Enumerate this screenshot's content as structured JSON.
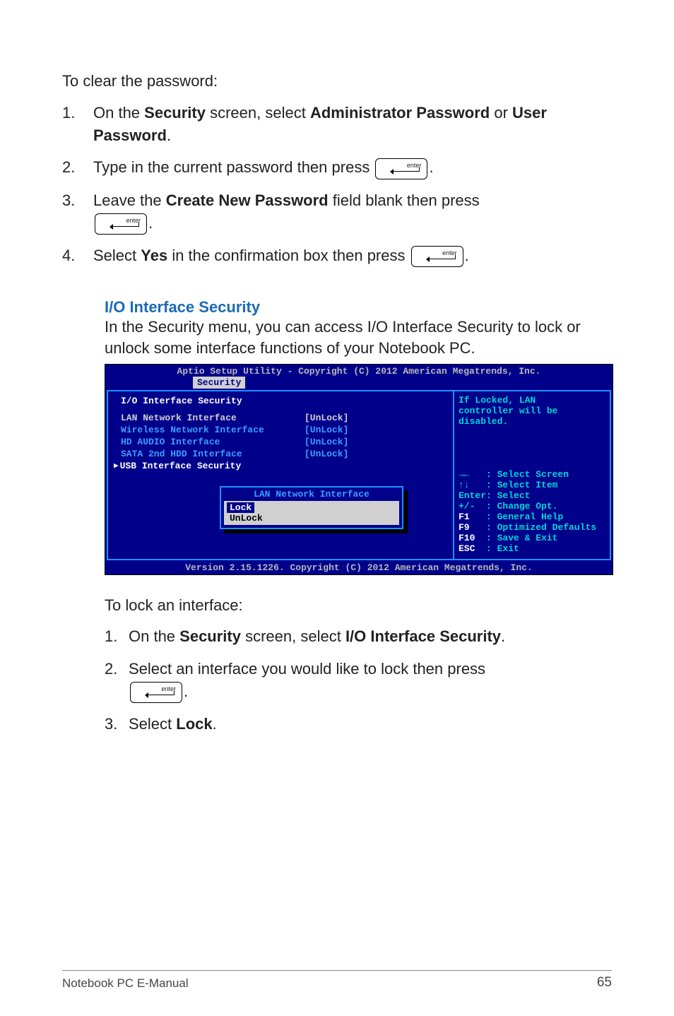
{
  "intro": "To clear the password:",
  "steps": [
    {
      "num": "1.",
      "pre": "On the ",
      "b1": "Security",
      "mid": " screen, select ",
      "b2": "Administrator Password",
      "post": " or ",
      "b3": "User Password",
      "tail": "."
    },
    {
      "num": "2.",
      "text": "Type in the current password then press ",
      "tail": "."
    },
    {
      "num": "3.",
      "pre": "Leave the ",
      "b1": "Create New Password",
      "post": " field blank then press ",
      "tail": "."
    },
    {
      "num": "4.",
      "pre": "Select ",
      "b1": "Yes",
      "post": " in the confirmation box then press ",
      "tail": "."
    }
  ],
  "sub": {
    "heading": "I/O Interface Security",
    "para": "In the Security menu, you can access I/O Interface Security to lock or unlock some interface functions of your Notebook PC."
  },
  "bios": {
    "title": "Aptio Setup Utility - Copyright (C) 2012 American Megatrends, Inc.",
    "tab": "Security",
    "section": "I/O Interface Security",
    "rows": [
      {
        "label": "LAN Network Interface",
        "val": "[UnLock]",
        "sel": true
      },
      {
        "label": "Wireless Network Interface",
        "val": "[UnLock]",
        "sel": false
      },
      {
        "label": "HD AUDIO Interface",
        "val": "[UnLock]",
        "sel": false
      },
      {
        "label": "SATA 2nd HDD Interface",
        "val": "[UnLock]",
        "sel": false
      }
    ],
    "cursor": "USB Interface Security",
    "popup": {
      "title": "LAN Network Interface",
      "options": [
        "Lock",
        "UnLock"
      ],
      "selected": 0
    },
    "help_top": "If Locked, LAN\ncontroller will be\ndisabled.",
    "help_nav": "→←   : Select Screen\n↑↓   : Select Item\nEnter: Select\n+/-  : Change Opt.",
    "help_keys": [
      {
        "k": "F1",
        "d": "General Help"
      },
      {
        "k": "F9",
        "d": "Optimized Defaults"
      },
      {
        "k": "F10",
        "d": "Save & Exit"
      },
      {
        "k": "ESC",
        "d": "Exit"
      }
    ],
    "footer": "Version 2.15.1226. Copyright (C) 2012 American Megatrends, Inc."
  },
  "lock": {
    "intro": "To lock an interface:",
    "steps": [
      {
        "num": "1.",
        "pre": "On the ",
        "b1": "Security",
        "mid": " screen, select ",
        "b2": "I/O Interface Security",
        "tail": "."
      },
      {
        "num": "2.",
        "text": "Select an interface you would like to lock then press ",
        "tail": "."
      },
      {
        "num": "3.",
        "pre": "Select ",
        "b1": "Lock",
        "tail": "."
      }
    ]
  },
  "footer": {
    "left": "Notebook PC E-Manual",
    "right": "65"
  }
}
